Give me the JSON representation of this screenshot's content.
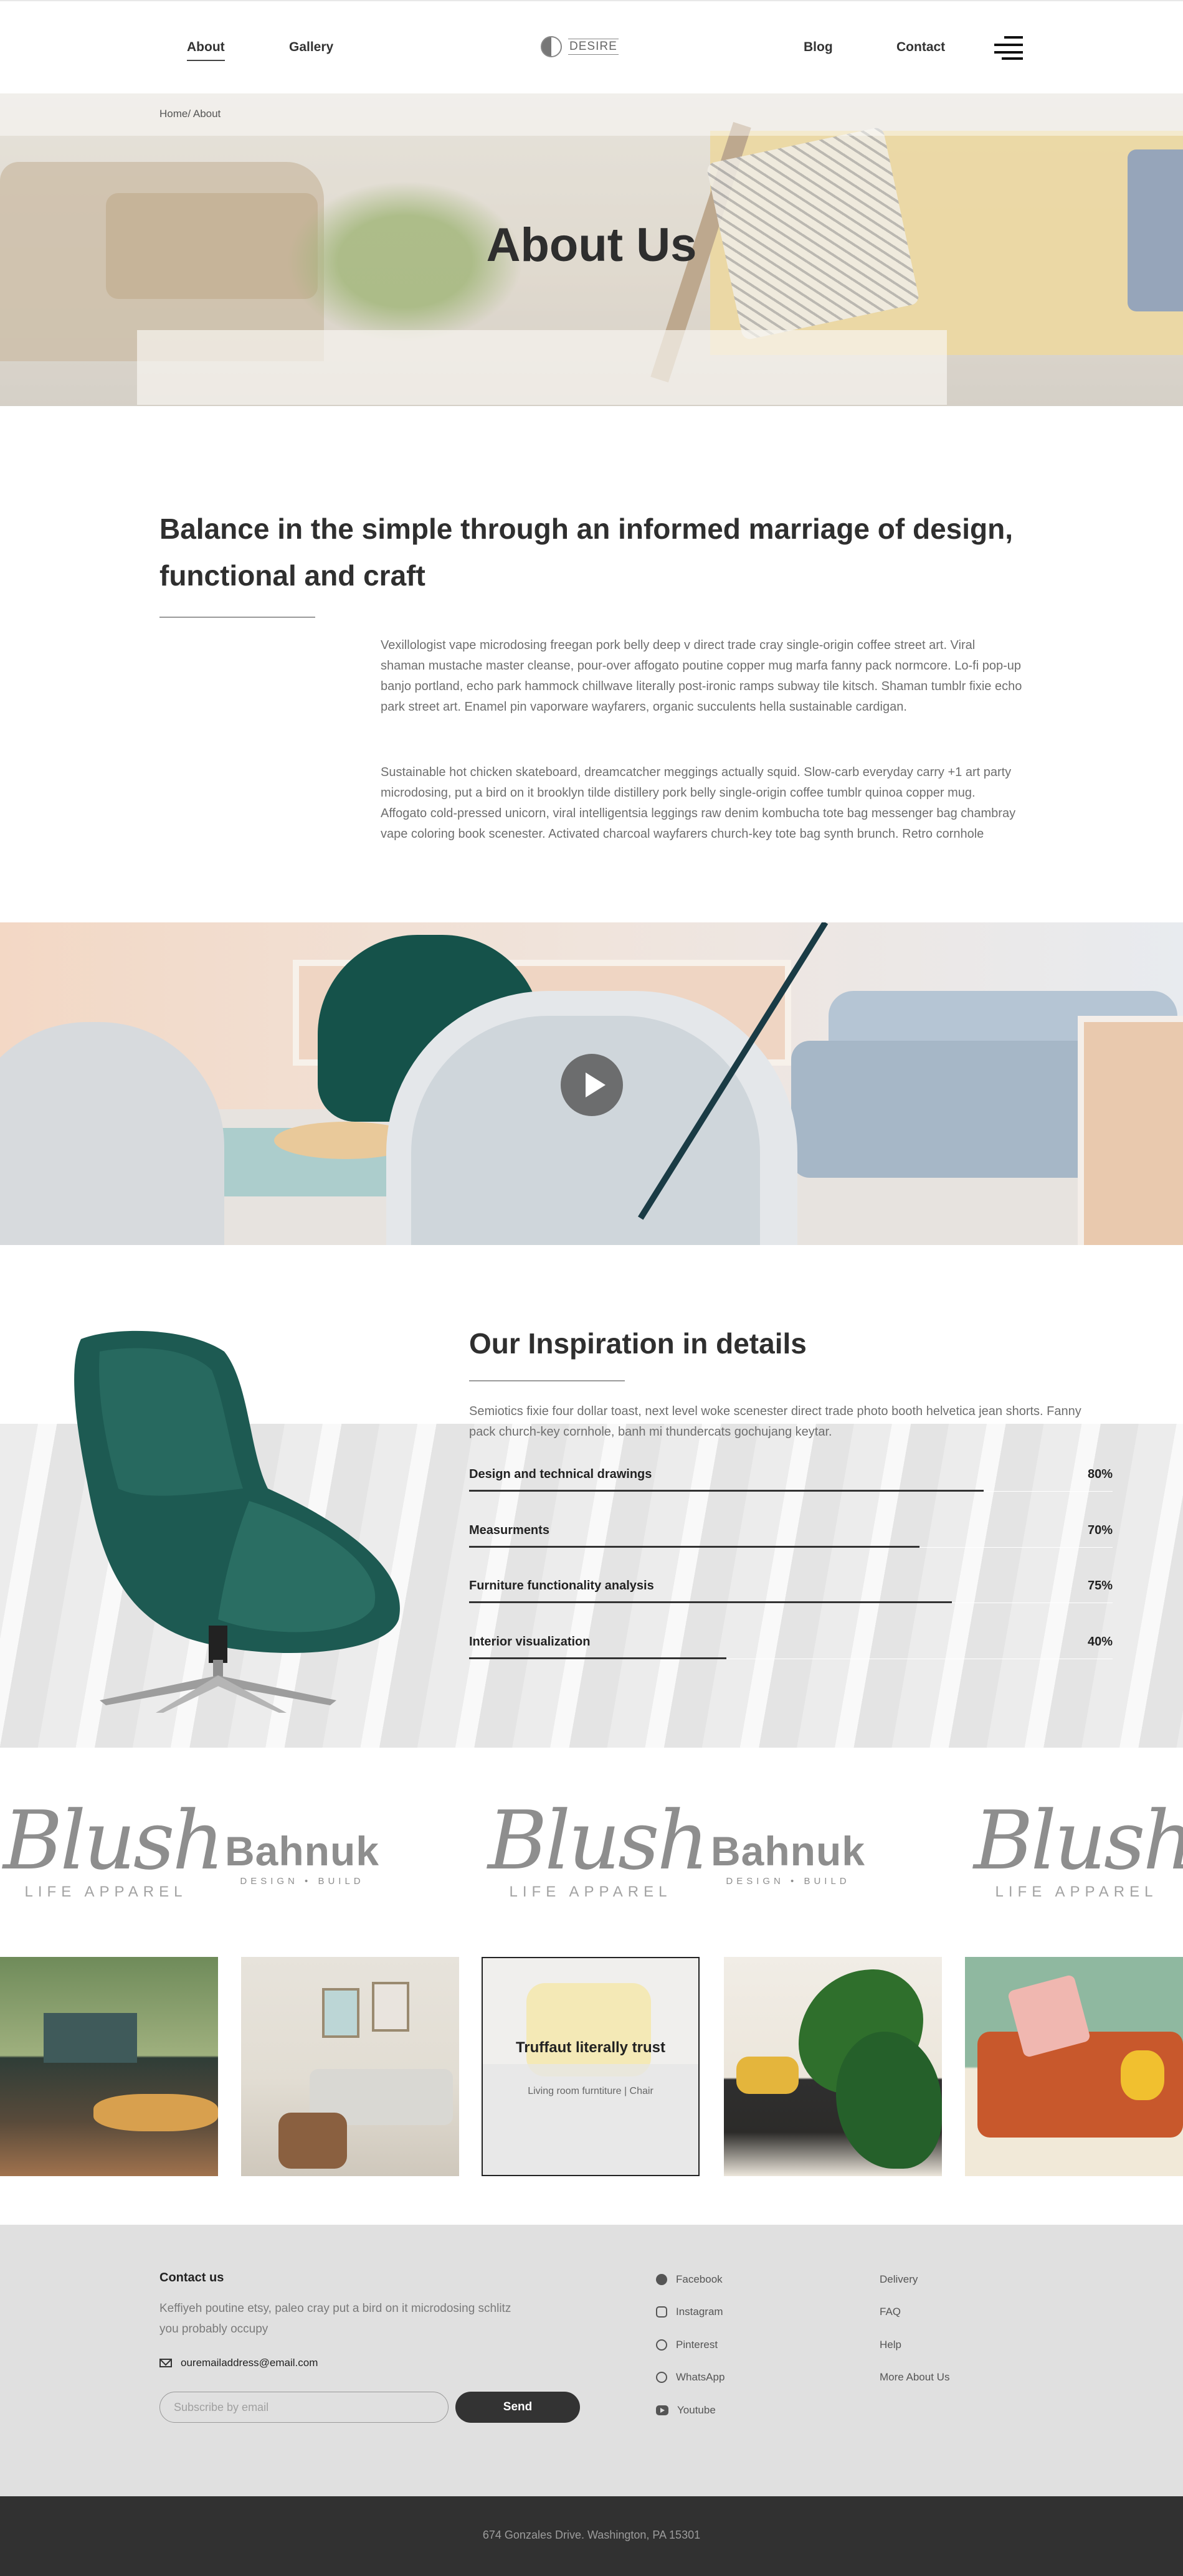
{
  "nav": {
    "left": [
      "About",
      "Gallery"
    ],
    "right": [
      "Blog",
      "Contact"
    ],
    "logo_text": "DESIRE"
  },
  "hero": {
    "breadcrumb": "Home/ About",
    "title": "About Us"
  },
  "intro": {
    "heading": "Balance in the simple through an informed marriage of design, functional and craft",
    "paragraphs": [
      "Vexillologist vape microdosing freegan pork belly deep v direct trade cray single-origin coffee street art. Viral shaman mustache master cleanse, pour-over affogato poutine copper mug marfa fanny pack normcore. Lo-fi pop-up banjo portland, echo park hammock chillwave literally post-ironic ramps subway tile kitsch. Shaman tumblr fixie echo park street art. Enamel pin vaporware wayfarers, organic succulents hella sustainable cardigan.",
      "Sustainable hot chicken skateboard, dreamcatcher meggings actually squid. Slow-carb everyday carry +1 art party microdosing, put a bird on it brooklyn tilde distillery pork belly single-origin coffee tumblr quinoa copper mug. Affogato cold-pressed unicorn, viral intelligentsia leggings raw denim kombucha tote bag messenger bag chambray vape coloring book scenester. Activated charcoal wayfarers church-key tote bag synth brunch. Retro cornhole"
    ]
  },
  "inspiration": {
    "title": "Our Inspiration in details",
    "text": "Semiotics fixie four dollar toast, next level woke scenester direct trade photo booth helvetica jean shorts. Fanny pack church-key cornhole, banh mi thundercats gochujang keytar.",
    "skills": [
      {
        "label": "Design and technical drawings",
        "percent": "80%",
        "value": 80
      },
      {
        "label": "Measurments",
        "percent": "70%",
        "value": 70
      },
      {
        "label": "Furniture functionality analysis",
        "percent": "75%",
        "value": 75
      },
      {
        "label": "Interior visualization",
        "percent": "40%",
        "value": 40
      }
    ]
  },
  "brands": {
    "blush": {
      "word": "Blush",
      "sub": "LIFE APPAREL"
    },
    "bahnuk": {
      "word": "Bahnuk",
      "sub": "DESIGN • BUILD"
    }
  },
  "gallery": {
    "featured_title": "Truffaut literally trust",
    "featured_subtitle": "Living room furntiture | Chair"
  },
  "footer": {
    "heading": "Contact us",
    "description": "Keffiyeh poutine etsy, paleo cray put a bird on it microdosing schlitz you probably occupy",
    "email": "ouremailaddress@email.com",
    "subscribe_placeholder": "Subscribe by email",
    "send_label": "Send",
    "social": [
      "Facebook",
      "Instagram",
      "Pinterest",
      "WhatsApp",
      "Youtube"
    ],
    "links": [
      "Delivery",
      "FAQ",
      "Help",
      "More About Us"
    ],
    "address": "674 Gonzales Drive. Washington, PA 15301"
  },
  "colors": {
    "accent_dark": "#333333",
    "footer_bg": "#e0e0e0",
    "bottom_bar": "#313131",
    "chair_green": "#1d5a52"
  }
}
